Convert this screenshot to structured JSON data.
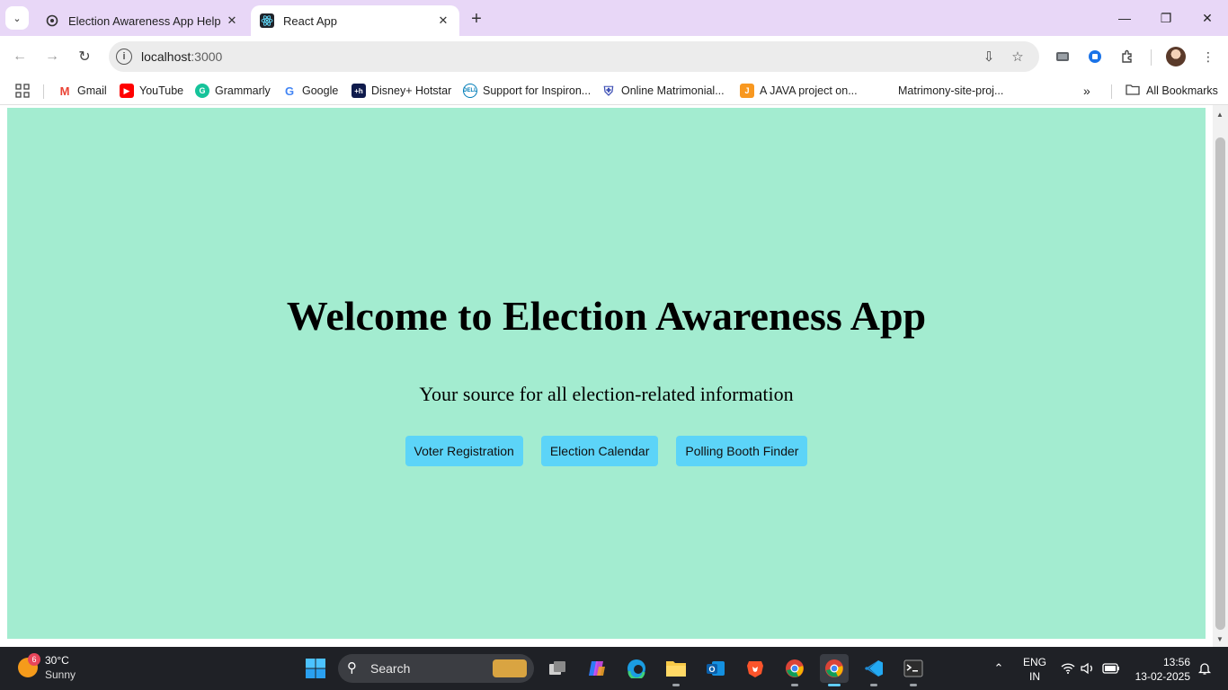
{
  "browser": {
    "tabs": [
      {
        "title": "Election Awareness App Help",
        "favicon": "openai-icon",
        "active": false
      },
      {
        "title": "React App",
        "favicon": "react-icon",
        "active": true
      }
    ],
    "address": {
      "host": "localhost",
      "port": ":3000"
    },
    "bookmarks": [
      {
        "label": "Gmail",
        "icon": "gmail-icon",
        "color": "#ea4335"
      },
      {
        "label": "YouTube",
        "icon": "youtube-icon",
        "color": "#ff0000"
      },
      {
        "label": "Grammarly",
        "icon": "grammarly-icon",
        "color": "#15c39a"
      },
      {
        "label": "Google",
        "icon": "google-icon",
        "color": "#4285f4"
      },
      {
        "label": "Disney+ Hotstar",
        "icon": "hotstar-icon",
        "color": "#0f1b4c"
      },
      {
        "label": "Support for Inspiron...",
        "icon": "dell-icon",
        "color": "#007db8"
      },
      {
        "label": "Online Matrimonial...",
        "icon": "shield-icon",
        "color": "#3f51b5"
      },
      {
        "label": "A JAVA project on...",
        "icon": "java-icon",
        "color": "#f89820"
      },
      {
        "label": "Matrimony-site-proj...",
        "icon": "",
        "color": ""
      }
    ],
    "all_bookmarks": "All Bookmarks"
  },
  "page": {
    "heading": "Welcome to Election Awareness App",
    "subtitle": "Your source for all election-related information",
    "buttons": [
      "Voter Registration",
      "Election Calendar",
      "Polling Booth Finder"
    ],
    "background": "#a3ecd0",
    "button_color": "#5cd4f8"
  },
  "taskbar": {
    "weather": {
      "badge": "6",
      "temp": "30°C",
      "desc": "Sunny"
    },
    "search_label": "Search",
    "lang": {
      "line1": "ENG",
      "line2": "IN"
    },
    "clock": {
      "time": "13:56",
      "date": "13-02-2025"
    }
  }
}
